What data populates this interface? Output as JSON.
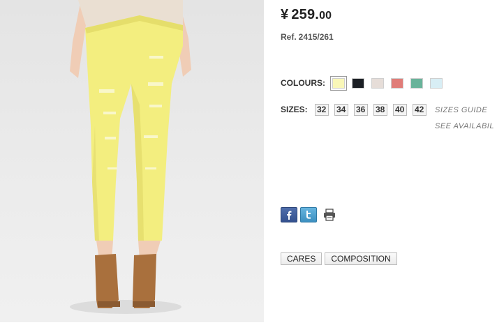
{
  "product": {
    "image_alt": "",
    "price": {
      "currency": "¥",
      "whole": "259.",
      "cents": "00"
    },
    "reference": {
      "label": "Ref.",
      "value": "2415/261"
    }
  },
  "colours": {
    "label": "COLOURS:",
    "swatches": [
      {
        "name": "yellow",
        "color": "#f9f7b8",
        "selected": true
      },
      {
        "name": "black",
        "color": "#1b1f24",
        "selected": false
      },
      {
        "name": "beige",
        "color": "#e6ddd8",
        "selected": false
      },
      {
        "name": "coral",
        "color": "#e07c78",
        "selected": false
      },
      {
        "name": "green",
        "color": "#69b39a",
        "selected": false
      },
      {
        "name": "light-blue",
        "color": "#d8eef5",
        "selected": false
      }
    ]
  },
  "sizes": {
    "label": "SIZES:",
    "options": [
      "32",
      "34",
      "36",
      "38",
      "40",
      "42"
    ],
    "guide_link": "SIZES GUIDE",
    "availability_link": "SEE AVAILABIL"
  },
  "share": {
    "icons": [
      "facebook-icon",
      "twitter-icon",
      "printer-icon"
    ]
  },
  "tabs": [
    "CARES",
    "COMPOSITION"
  ],
  "colors": {
    "jeans": "#f3ee7f",
    "skin": "#f1d2bd",
    "top": "#eadfd2",
    "shoes": "#a9703d"
  }
}
